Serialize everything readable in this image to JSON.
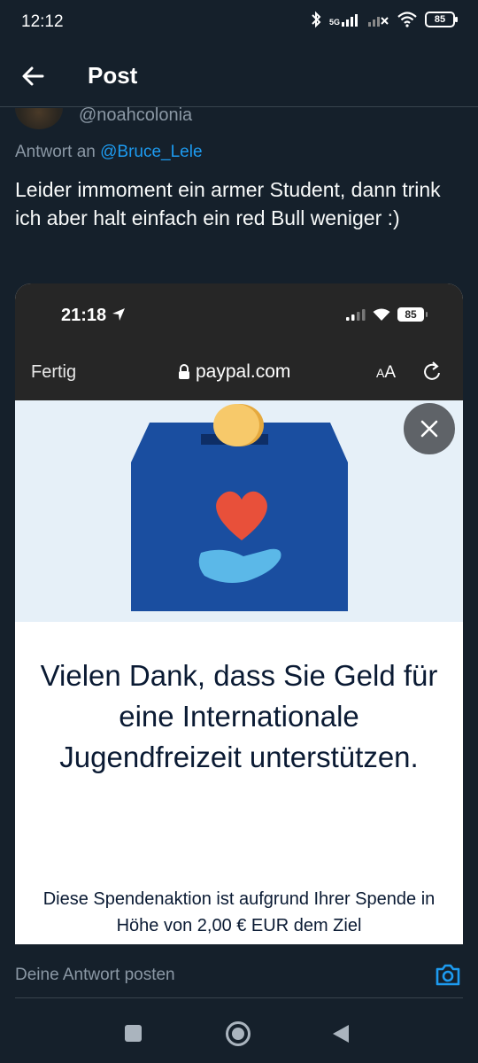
{
  "status_bar": {
    "time": "12:12",
    "network": "5G",
    "battery": "85"
  },
  "header": {
    "title": "Post"
  },
  "post": {
    "handle": "@noahcolonia",
    "reply_prefix": "Antwort an",
    "reply_mention": "@Bruce_Lele",
    "text": "Leider immoment ein armer Student, dann trink ich aber halt einfach ein red Bull weniger :)"
  },
  "embedded_screenshot": {
    "ios_time": "21:18",
    "ios_battery": "85",
    "done_label": "Fertig",
    "url": "paypal.com",
    "text_size_label": "AA",
    "thanks_heading": "Vielen Dank, dass Sie Geld für eine Internationale Jugendfreizeit unterstützen.",
    "description": "Diese Spendenaktion ist aufgrund Ihrer Spende in Höhe von 2,00 € EUR dem Ziel"
  },
  "reply_bar": {
    "placeholder": "Deine Antwort posten"
  },
  "colors": {
    "background": "#15202b",
    "accent": "#1d9bf0",
    "muted_text": "#8b98a5",
    "paypal_box": "#1a4ea0",
    "heart": "#e8503a",
    "hand": "#5bb8e8",
    "coin": "#f7c96a"
  }
}
